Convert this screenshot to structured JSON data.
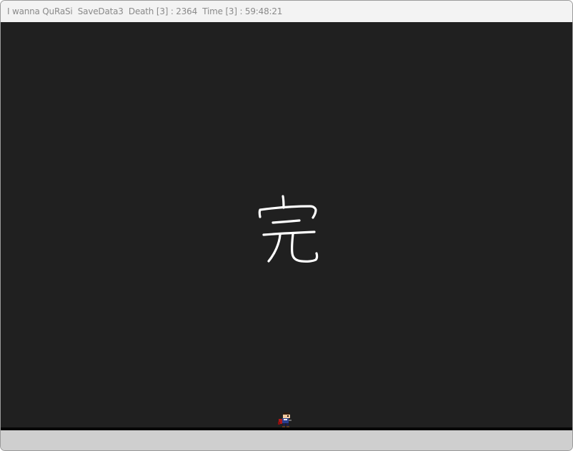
{
  "window": {
    "title": "I wanna QuRaSi  SaveData3  Death [3] : 2364  Time [3] : 59:48:21"
  },
  "game": {
    "center_glyph": "完",
    "background_color": "#202020",
    "glyph_color": "#ffffff",
    "player_icon": "kid-player-sprite"
  }
}
